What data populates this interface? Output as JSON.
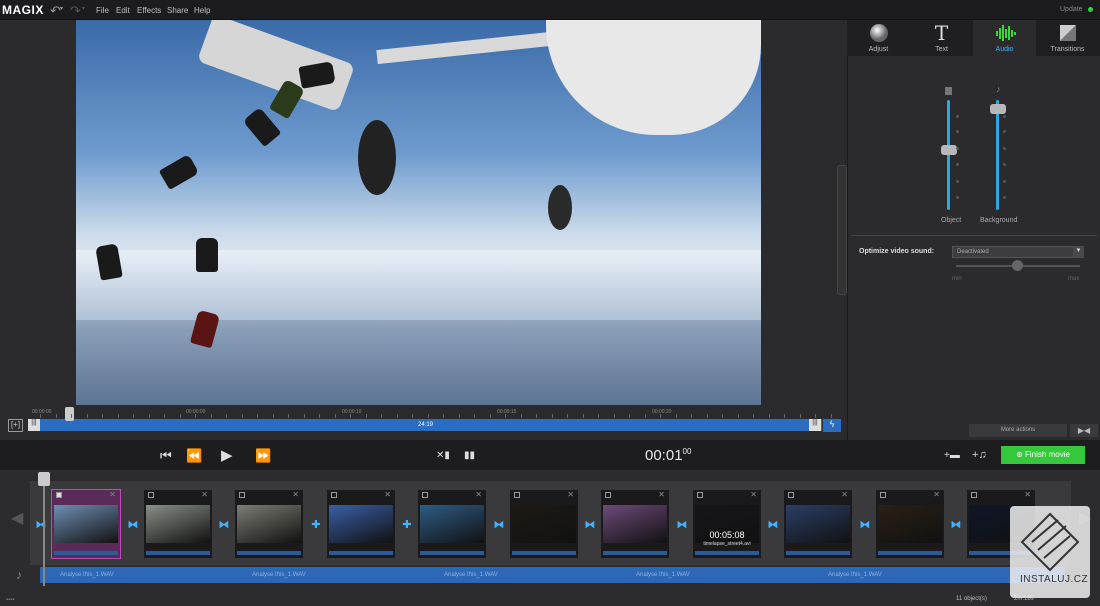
{
  "app": {
    "logo": "MAGIX",
    "update_label": "Update"
  },
  "menu": [
    "File",
    "Edit",
    "Effects",
    "Share",
    "Help"
  ],
  "tabs": [
    {
      "label": "Adjust",
      "icon": "sphere-icon"
    },
    {
      "label": "Text",
      "icon": "text-t-icon"
    },
    {
      "label": "Audio",
      "icon": "audio-wave-icon",
      "active": true
    },
    {
      "label": "Transitions",
      "icon": "transition-icon"
    }
  ],
  "audio_panel": {
    "object_label": "Object",
    "background_label": "Background",
    "object_level": 0.55,
    "background_level": 0.92,
    "optimize_label": "Optimize video sound:",
    "optimize_value": "Deactivated",
    "min_label": "min",
    "max_label": "max",
    "optimize_level": 0.45,
    "more_actions": "More actions"
  },
  "scrubber": {
    "ticks": [
      "00:00:00",
      "00:00:00",
      "00:00:10",
      "00:00:15",
      "00:00:20"
    ],
    "length_label": "24:19"
  },
  "transport": {
    "timecode": "00:01",
    "frames": "00",
    "finish_label": "Finish movie"
  },
  "storyboard": {
    "clips": [
      {
        "color": "#6f8fb3",
        "selected": true
      },
      {
        "color": "#8a8f88"
      },
      {
        "color": "#7c7d74"
      },
      {
        "color": "#3a5fa6"
      },
      {
        "color": "#2d5d86"
      },
      {
        "color": "#1d1a14"
      },
      {
        "color": "#6d4a7a"
      },
      {
        "color": "#16161a",
        "time": "00:05:08",
        "filename": "timelapse_street4.avi"
      },
      {
        "color": "#2a3f66"
      },
      {
        "color": "#2a2016"
      },
      {
        "color": "#0f1628"
      }
    ],
    "audio_labels": [
      "Analyse this_1.WAV",
      "Analyse this_1.WAV",
      "Analyse this_1.WAV",
      "Analyse this_1.WAV",
      "Analyse this_1.WAV"
    ],
    "objects": "11 object(s)",
    "duration": "2m:18s"
  },
  "watermark": "INSTALUJ.CZ"
}
